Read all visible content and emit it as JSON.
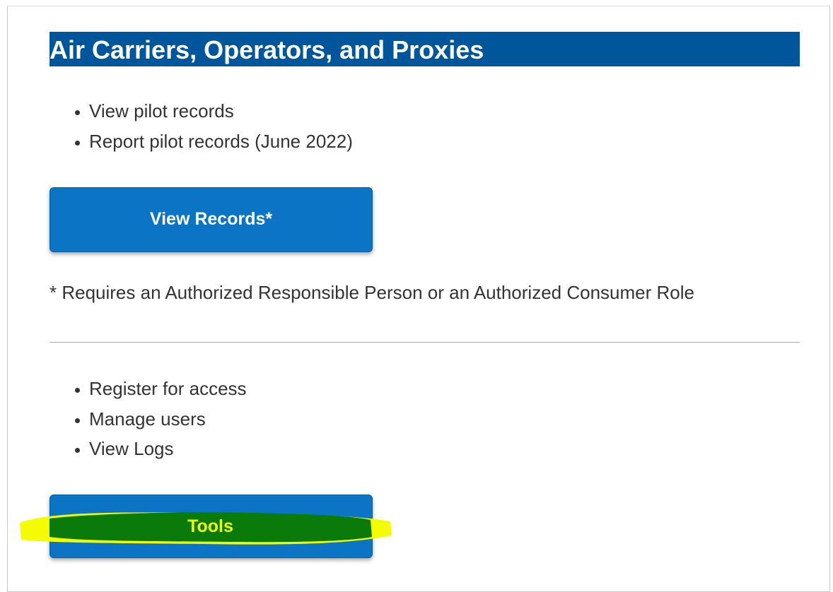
{
  "section": {
    "title": "Air Carriers, Operators, and Proxies"
  },
  "records_list": [
    "View pilot records",
    "Report pilot records (June 2022)"
  ],
  "view_records_button": "View Records*",
  "note": "* Requires an Authorized Responsible Person or an Authorized Consumer Role",
  "tools_list": [
    "Register for access",
    "Manage users",
    "View Logs"
  ],
  "tools_button": "Tools",
  "colors": {
    "heading_bg": "#00569b",
    "button_bg": "#0b74c4",
    "highlight_yellow": "#f5fb00",
    "highlight_green": "#0a7a0a"
  }
}
